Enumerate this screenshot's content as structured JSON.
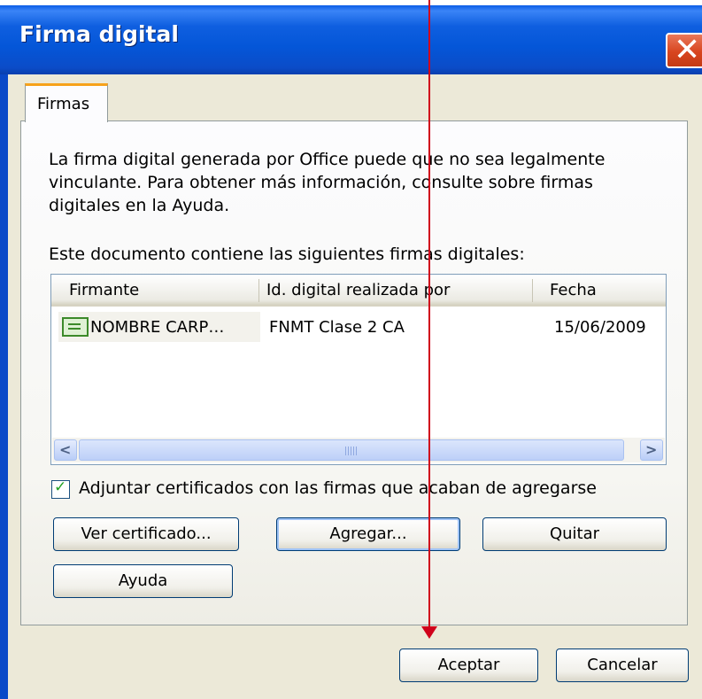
{
  "window": {
    "title": "Firma digital"
  },
  "tabs": [
    {
      "label": "Firmas"
    }
  ],
  "description": "La firma digital generada por Office puede que no sea legalmente vinculante. Para obtener más información, consulte sobre firmas digitales en la Ayuda.",
  "list_label": "Este documento contiene las siguientes firmas digitales:",
  "table": {
    "columns": [
      "Firmante",
      "Id. digital realizada por",
      "Fecha"
    ],
    "rows": [
      {
        "signer": "NOMBRE CARP…",
        "issued_by": "FNMT Clase 2 CA",
        "date": "15/06/2009",
        "icon": "certificate-icon"
      }
    ]
  },
  "checkbox": {
    "label": "Adjuntar certificados con las firmas que acaban de agregarse",
    "checked": true
  },
  "buttons": {
    "view_cert": "Ver certificado...",
    "add": "Agregar...",
    "remove": "Quitar",
    "help": "Ayuda",
    "ok": "Aceptar",
    "cancel": "Cancelar"
  },
  "colors": {
    "titlebar": "#0456d8",
    "tab_accent": "#f7a21b",
    "annotation_arrow": "#d0021b",
    "close_button": "#d8451f"
  }
}
